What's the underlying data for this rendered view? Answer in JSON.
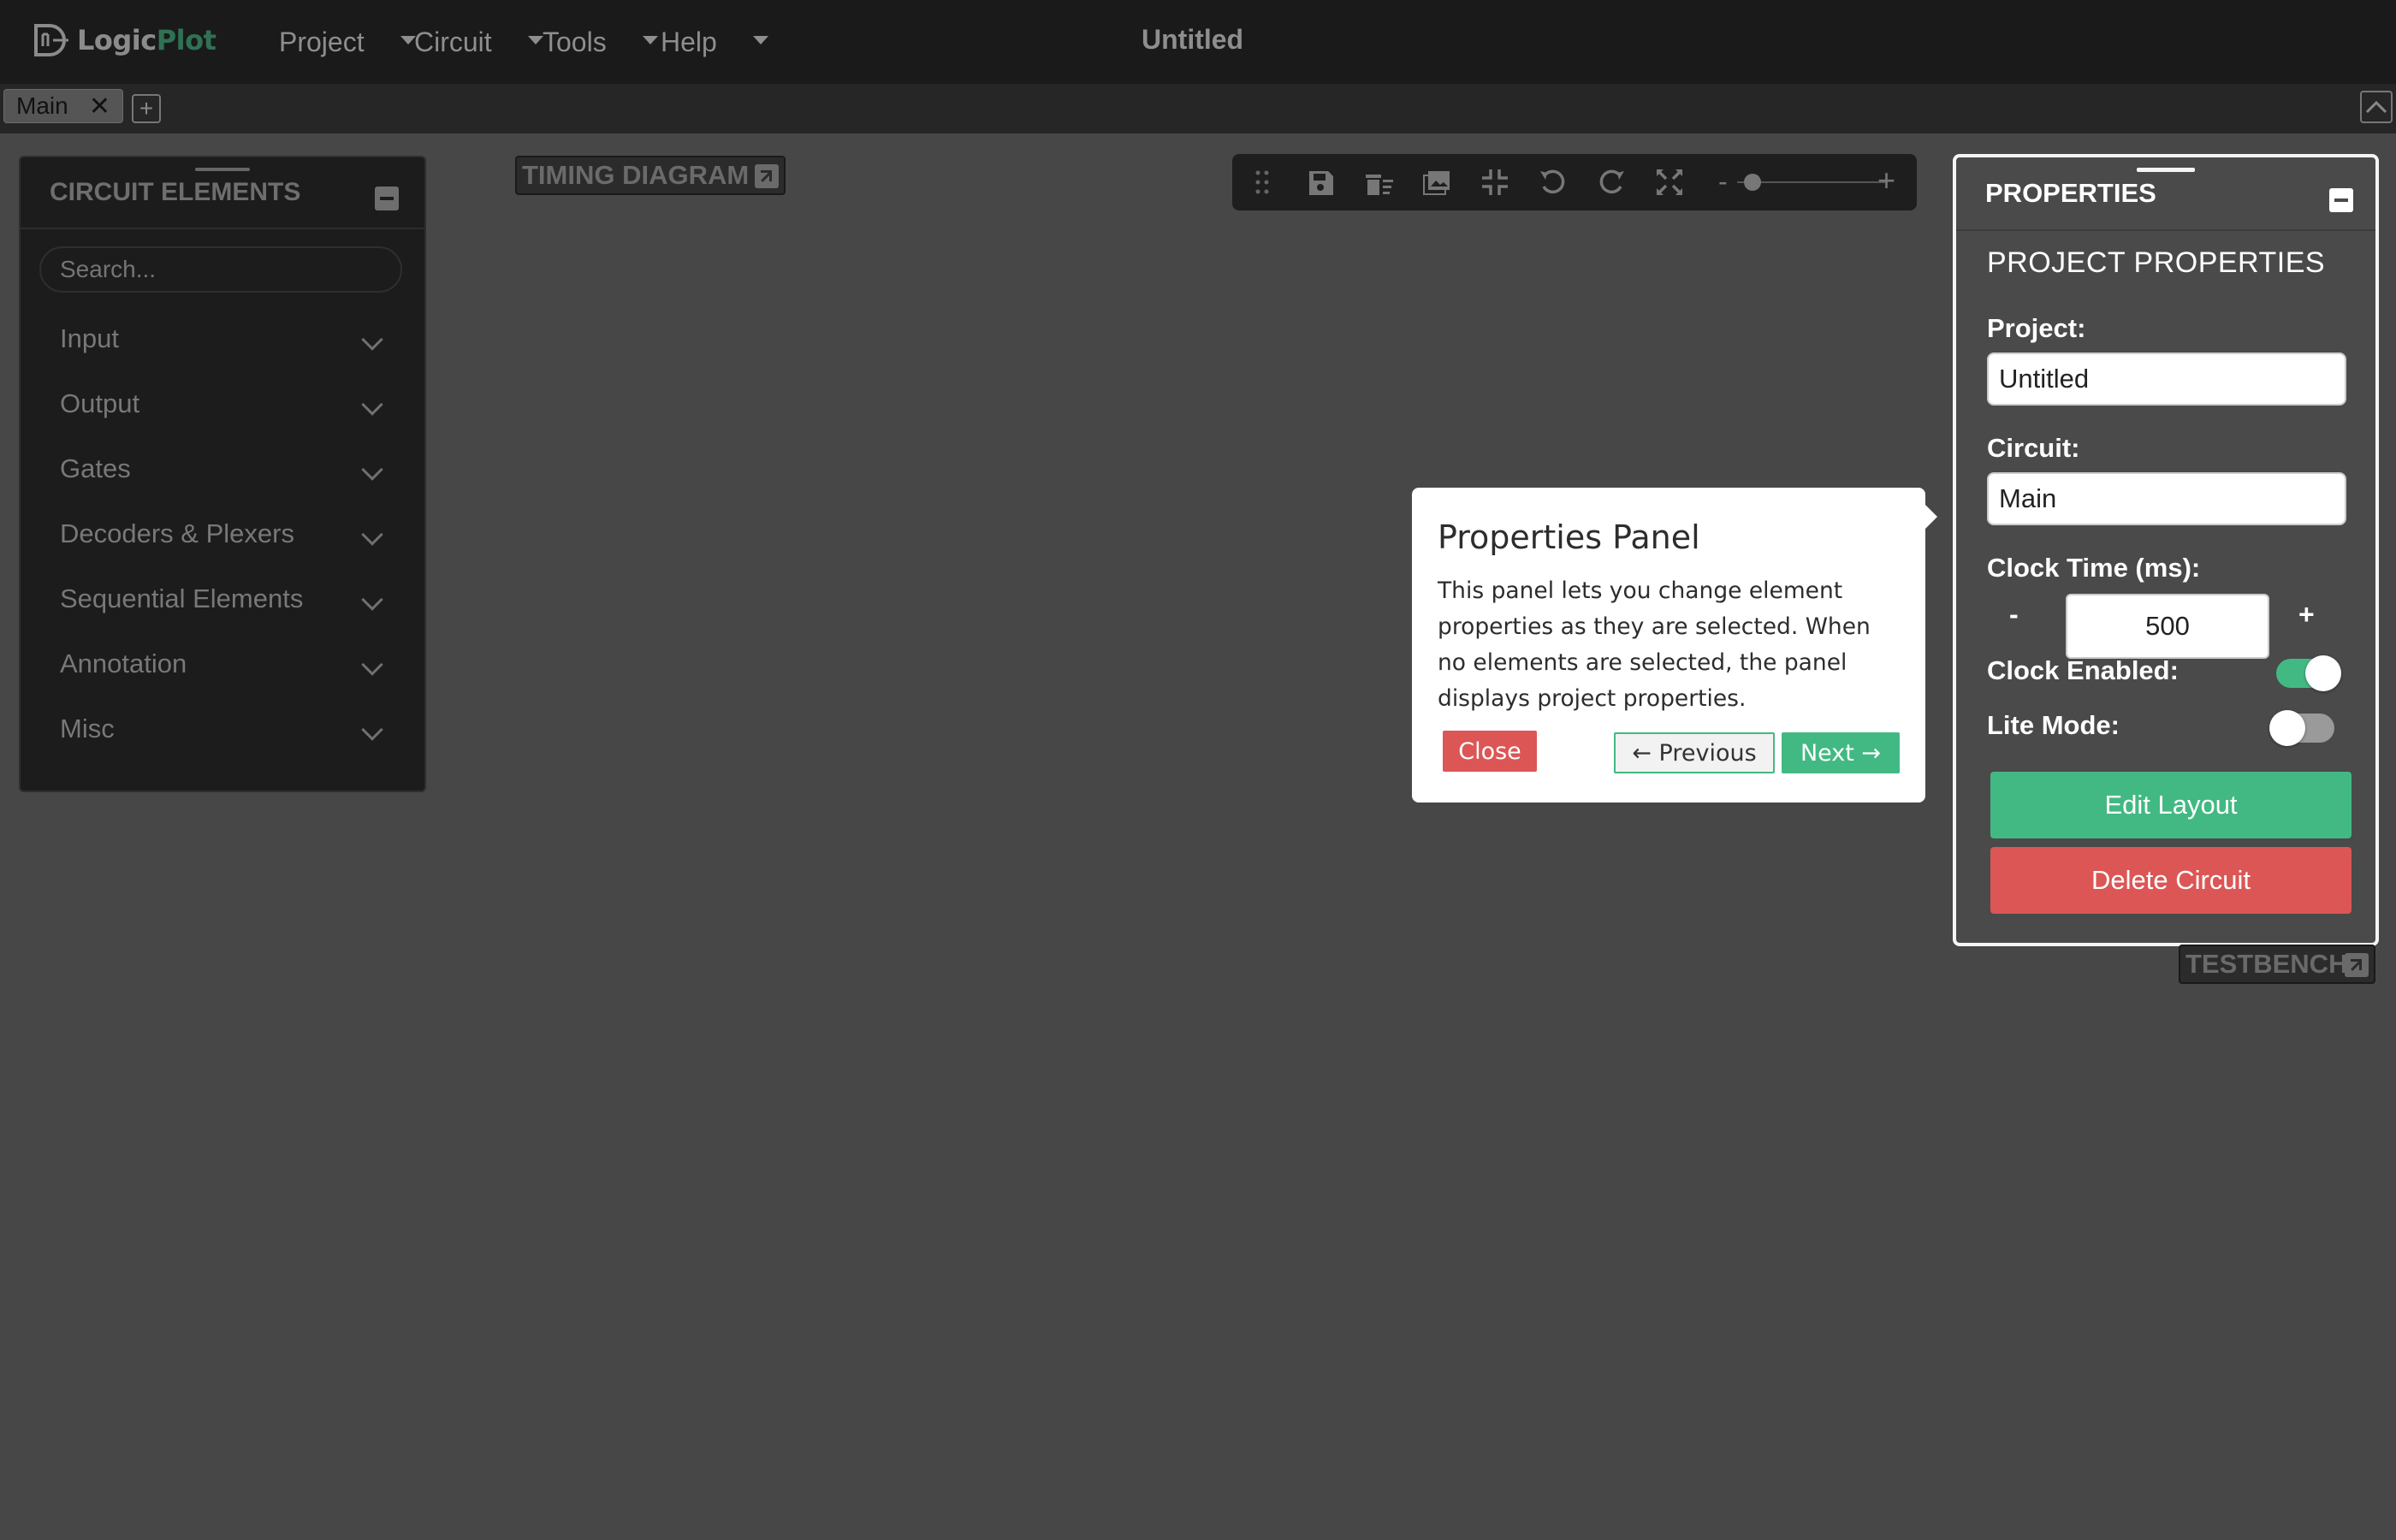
{
  "app": {
    "logo_logic": "Logic",
    "logo_plot": "Plot",
    "title": "Untitled"
  },
  "menu": [
    {
      "label": "Project"
    },
    {
      "label": "Circuit"
    },
    {
      "label": "Tools"
    },
    {
      "label": "Help"
    }
  ],
  "tabs": [
    {
      "label": "Main",
      "close": "✕"
    }
  ],
  "tab_add": "+",
  "circuit_elements": {
    "title": "CIRCUIT ELEMENTS",
    "search_placeholder": "Search...",
    "groups": [
      {
        "label": "Input"
      },
      {
        "label": "Output"
      },
      {
        "label": "Gates"
      },
      {
        "label": "Decoders & Plexers"
      },
      {
        "label": "Sequential Elements"
      },
      {
        "label": "Annotation"
      },
      {
        "label": "Misc"
      }
    ]
  },
  "timing_diagram": {
    "label": "TIMING DIAGRAM"
  },
  "toolbar": {
    "icons": [
      "drag-handle-icon",
      "save-icon",
      "delete-all-icon",
      "image-icon",
      "shrink-icon",
      "undo-icon",
      "redo-icon",
      "fullscreen-icon"
    ],
    "zoom_minus": "-",
    "zoom_plus": "+",
    "zoom_level": 0.1
  },
  "properties": {
    "title": "PROPERTIES",
    "section_title": "PROJECT PROPERTIES",
    "project_label": "Project:",
    "project_value": "Untitled",
    "circuit_label": "Circuit:",
    "circuit_value": "Main",
    "clock_time_label": "Clock Time (ms):",
    "clock_minus": "-",
    "clock_plus": "+",
    "clock_time_value": "500",
    "clock_enabled_label": "Clock Enabled:",
    "clock_enabled": true,
    "lite_mode_label": "Lite Mode:",
    "lite_mode": false,
    "edit_layout": "Edit Layout",
    "delete_circuit": "Delete Circuit"
  },
  "testbench": {
    "label": "TESTBENCH"
  },
  "tour": {
    "title": "Properties Panel",
    "description": "This panel lets you change element properties as they are selected. When no elements are selected, the panel displays project properties.",
    "close": "Close",
    "previous": "← Previous",
    "next": "Next →"
  },
  "colors": {
    "accent_green": "#42b983",
    "danger_red": "#dc5656",
    "navbar_bg": "#1a1a1a",
    "canvas_bg": "#474747"
  }
}
